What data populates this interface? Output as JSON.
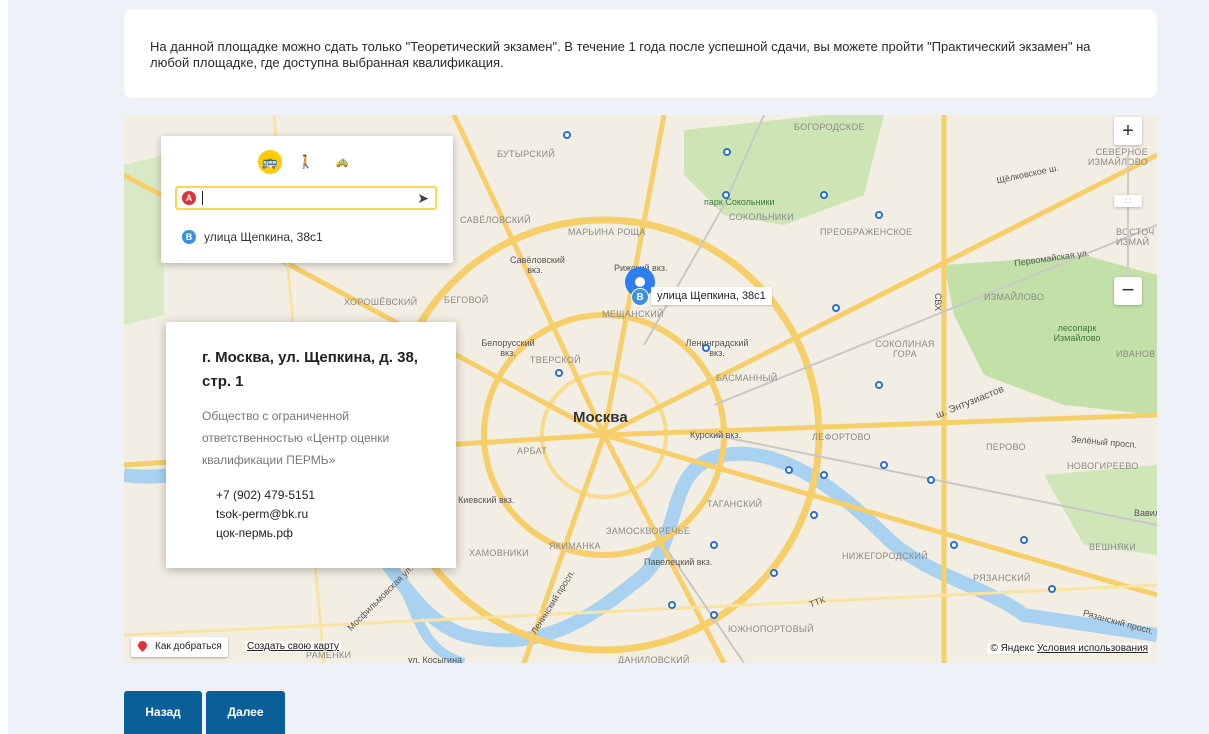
{
  "notice": {
    "text": "На данной площадке можно сдать только \"Теоретический экзамен\". В течение 1 года после успешной сдачи, вы можете пройти \"Практический экзамен\" на любой площадке, где доступна выбранная квалификация."
  },
  "colors": {
    "page_bg": "#eef2f8",
    "button": "#0b5f98",
    "marker": "#2d7ff0",
    "point_a": "#e0303a",
    "point_b": "#3b8fe0",
    "bus_active": "#ffcc00"
  },
  "route_panel": {
    "modes": [
      {
        "name": "bus",
        "icon": "bus-icon",
        "glyph": "🚌"
      },
      {
        "name": "walk",
        "icon": "walking-icon",
        "glyph": "🚶"
      },
      {
        "name": "taxi",
        "icon": "taxi-icon",
        "glyph": "🚕"
      }
    ],
    "point_a_letter": "A",
    "point_a_value": "",
    "point_b_letter": "B",
    "point_b_value": "улица Щепкина, 38с1"
  },
  "marker": {
    "letter": "B",
    "label": "улица Щепкина, 38с1"
  },
  "info_card": {
    "title": "г. Москва, ул. Щепкина, д. 38, стр. 1",
    "organization": "Общество с ограниченной ответственностью «Центр оценки квалификации ПЕРМЬ»",
    "phone": "+7 (902) 479-5151",
    "email": "tsok-perm@bk.ru",
    "website": "цок-пермь.рф"
  },
  "map_labels": {
    "city": "Москва",
    "districts": [
      "БОГОРОДСКОЕ",
      "БУТЫРСКИЙ",
      "МАРЬИНА РОЩА",
      "СОКОЛЬНИКИ",
      "ПРЕОБРАЖЕНСКОЕ",
      "ИЗМАЙЛОВО",
      "МЕЩАНСКИЙ",
      "ТВЕРСКОЙ",
      "БАСМАННЫЙ",
      "СОКОЛИНАЯ ГОРА",
      "ЛЕФОРТОВО",
      "ПЕРОВО",
      "НОВОГИРЕЕВО",
      "АРБАТ",
      "ТАГАНСКИЙ",
      "ЗАМОСКВОРЕЧЬЕ",
      "ЯКИМАНКА",
      "ХАМОВНИКИ",
      "НИЖЕГОРОДСКИЙ",
      "РЯЗАНСКИЙ",
      "ЮЖНОПОРТОВЫЙ",
      "ДАНИЛОВСКИЙ",
      "ХОРОШЁВСКИЙ",
      "БЕГОВОЙ",
      "САВЁЛОВСКИЙ",
      "ВЕШНЯКИ",
      "ИВАНОВ",
      "СЕВЕРНОЕ ИЗМАЙЛОВО",
      "ВОСТОЧ ИЗМАЙ",
      "РАМЕНКИ"
    ],
    "pois": [
      "парк Сокольники",
      "лесопарк Измайлово",
      "Савёловский вкз.",
      "Рижский вкз.",
      "Белорусский вкз.",
      "Ленинградский вкз.",
      "Курский вкз.",
      "Павелецкий вкз.",
      "Киевский вкз."
    ],
    "streets": [
      "Щёлковское ш.",
      "Первомайская ул.",
      "ш. Энтузиастов",
      "Зелёный просп.",
      "Рязанский просп.",
      "Ленинский просп.",
      "Мосфильмовская ул.",
      "ул. Косыгина",
      "ТТК",
      "СВХ",
      "Вавилова"
    ]
  },
  "map_controls": {
    "zoom_in": "+",
    "zoom_out": "−",
    "route_link": "Как добраться",
    "create_map_link": "Создать свою карту",
    "copyright": "© Яндекс",
    "terms_link": "Условия использования"
  },
  "nav": {
    "back_label": "Назад",
    "next_label": "Далее"
  }
}
